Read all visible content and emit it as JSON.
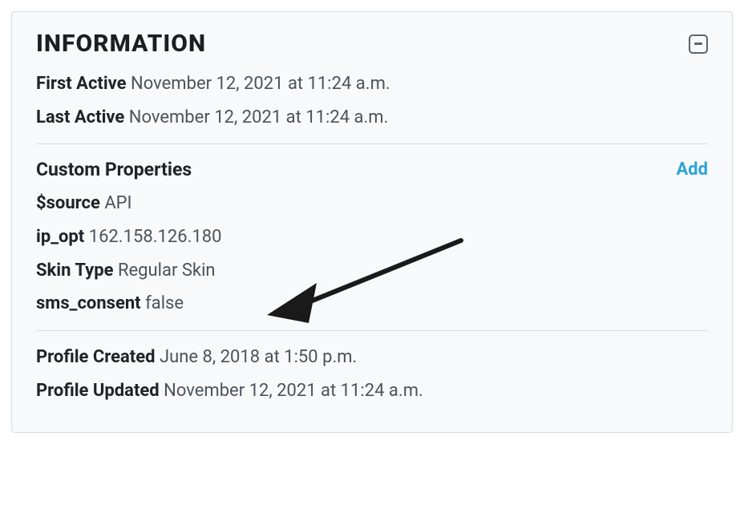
{
  "panel": {
    "title": "INFORMATION",
    "collapseIcon": "minus"
  },
  "activity": {
    "firstActive": {
      "label": "First Active",
      "value": "November 12, 2021 at 11:24 a.m."
    },
    "lastActive": {
      "label": "Last Active",
      "value": "November 12, 2021 at 11:24 a.m."
    }
  },
  "customProperties": {
    "heading": "Custom Properties",
    "addLabel": "Add",
    "items": [
      {
        "key": "$source",
        "value": "API"
      },
      {
        "key": "ip_opt",
        "value": "162.158.126.180"
      },
      {
        "key": "Skin Type",
        "value": "Regular Skin"
      },
      {
        "key": "sms_consent",
        "value": "false"
      }
    ]
  },
  "profile": {
    "created": {
      "label": "Profile Created",
      "value": "June 8, 2018 at 1:50 p.m."
    },
    "updated": {
      "label": "Profile Updated",
      "value": "November 12, 2021 at 11:24 a.m."
    }
  },
  "annotation": {
    "arrowColor": "#1a1a1a"
  }
}
